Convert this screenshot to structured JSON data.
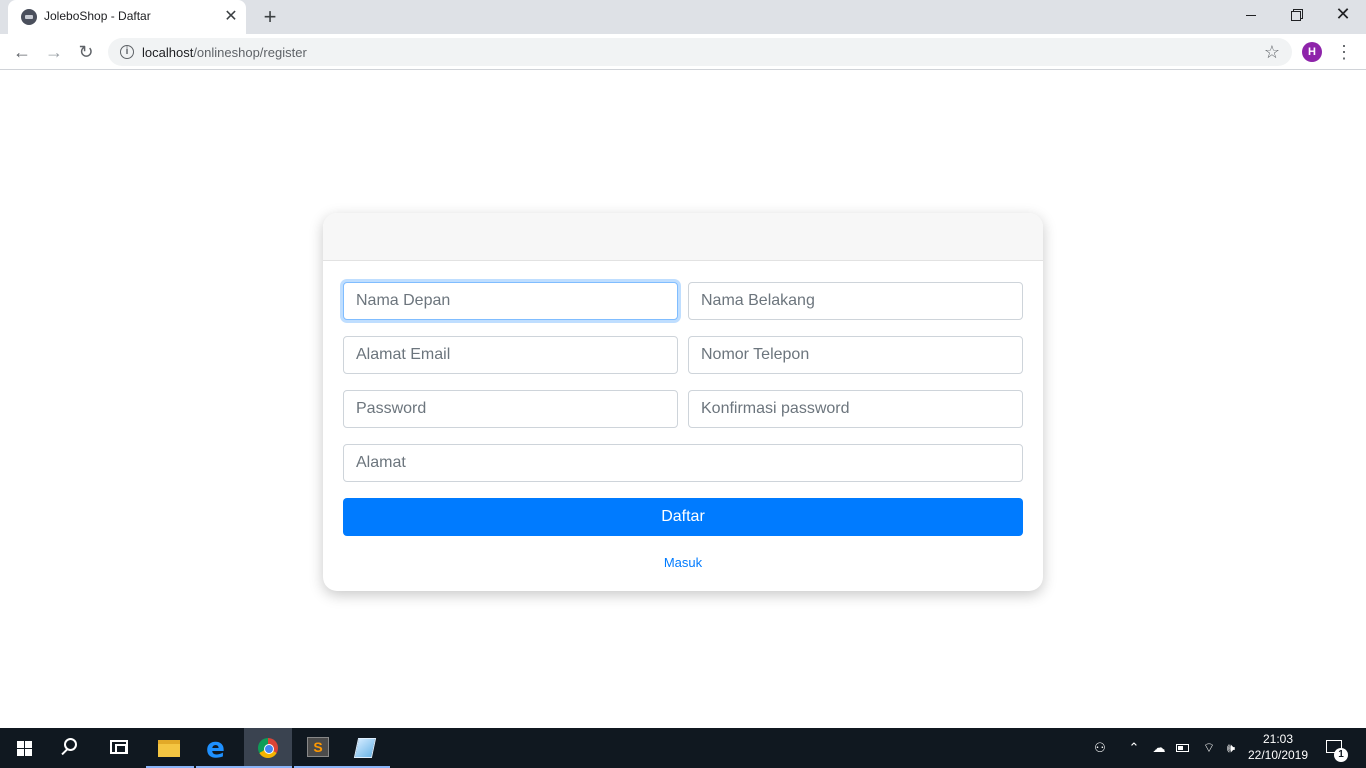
{
  "browser": {
    "tab_title": "JoleboShop - Daftar",
    "tab_close": "✕",
    "new_tab": "+",
    "url_host": "localhost",
    "url_path": "/onlineshop/register",
    "avatar_initial": "H",
    "back_icon": "arrow-back-icon",
    "forward_icon": "arrow-forward-icon",
    "reload_icon": "reload-icon",
    "star_icon": "bookmark-star-icon"
  },
  "form": {
    "first_name_placeholder": "Nama Depan",
    "last_name_placeholder": "Nama Belakang",
    "email_placeholder": "Alamat Email",
    "phone_placeholder": "Nomor Telepon",
    "password_placeholder": "Password",
    "confirm_password_placeholder": "Konfirmasi password",
    "address_placeholder": "Alamat",
    "submit_label": "Daftar",
    "login_link": "Masuk"
  },
  "taskbar": {
    "time": "21:03",
    "date": "22/10/2019",
    "notification_count": "1",
    "apps": [
      "start",
      "search",
      "task-view",
      "file-explorer",
      "edge",
      "chrome",
      "sublime-text",
      "notepad"
    ]
  },
  "colors": {
    "primary": "#007bff",
    "focus_border": "#80bdff",
    "taskbar": "#101820",
    "tabstrip": "#dee1e6"
  }
}
